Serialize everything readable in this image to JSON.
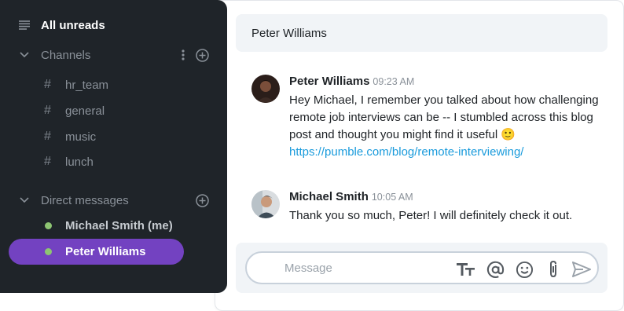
{
  "sidebar": {
    "all_unreads": "All unreads",
    "channels_section": "Channels",
    "channels": [
      "hr_team",
      "general",
      "music",
      "lunch"
    ],
    "dm_section": "Direct messages",
    "dms": [
      {
        "label": "Michael Smith (me)",
        "active": false
      },
      {
        "label": "Peter Williams",
        "active": true
      }
    ]
  },
  "header": {
    "title": "Peter Williams"
  },
  "messages": [
    {
      "author": "Peter Williams",
      "time": "09:23 AM",
      "text": "Hey Michael, I remember you talked about how challenging remote job interviews can be -- I stumbled across this blog post and thought you might find it useful 🙂",
      "link": "https://pumble.com/blog/remote-interviewing/"
    },
    {
      "author": "Michael Smith",
      "time": "10:05 AM",
      "text": "Thank you so much, Peter! I will definitely check it out."
    }
  ],
  "composer": {
    "placeholder": "Message",
    "value": ""
  },
  "colors": {
    "sidebar_bg": "#1f2429",
    "active_accent": "#7342c1",
    "online_dot": "#8dc572",
    "link": "#1a9bdc"
  },
  "icons": {
    "all_unreads": "list-lines-icon",
    "channels_menu": "kebab-menu-icon",
    "add": "plus-circle-icon",
    "format": "text-format-icon",
    "mention": "at-sign-icon",
    "emoji": "smiley-icon",
    "attach": "paperclip-icon",
    "send": "send-icon"
  }
}
